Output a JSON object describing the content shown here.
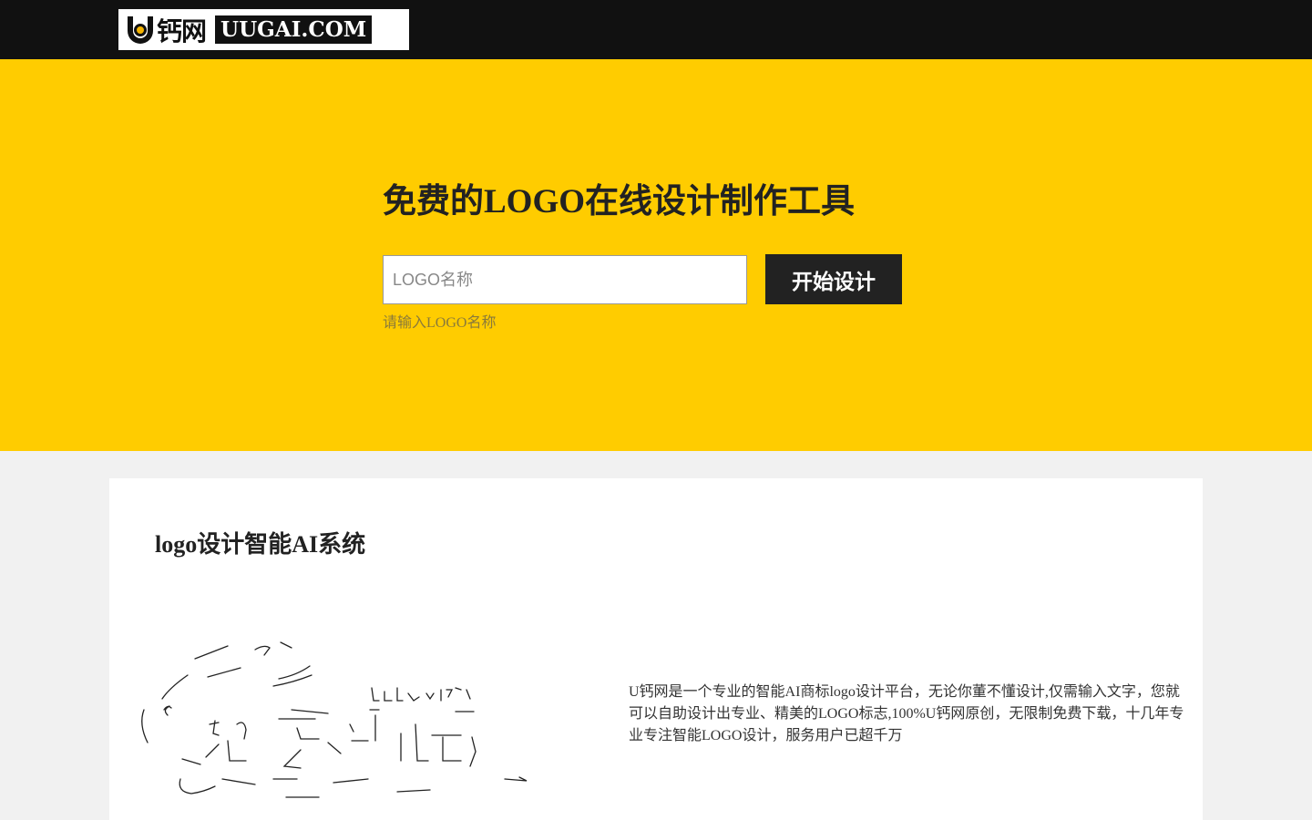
{
  "header": {
    "logo": {
      "cn_text": "钙网",
      "en_text": "UUGAI.COM",
      "mark": "u-gear-logo-icon"
    }
  },
  "hero": {
    "title": "免费的LOGO在线设计制作工具",
    "input": {
      "placeholder": "LOGO名称",
      "value": ""
    },
    "start_button_label": "开始设计",
    "hint": "请输入LOGO名称"
  },
  "section": {
    "title": "logo设计智能AI系统",
    "illustration": "hand-drawn-sketch-illustration",
    "description": "U钙网是一个专业的智能AI商标logo设计平台，无论你董不懂设计,仅需输入文字，您就可以自助设计出专业、精美的LOGO标志,100%U钙网原创，无限制免费下载，十几年专业专注智能LOGO设计，服务用户已超千万"
  },
  "colors": {
    "topbar": "#111111",
    "hero_bg": "#ffcc00",
    "button_bg": "#222222",
    "page_bg": "#f1f1f1"
  }
}
